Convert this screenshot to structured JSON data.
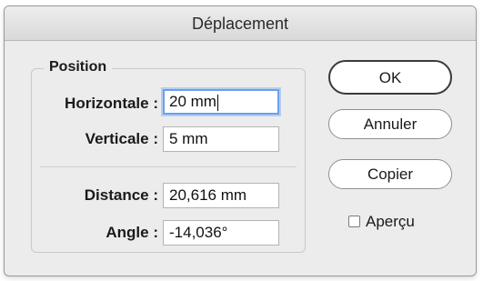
{
  "window": {
    "title": "Déplacement"
  },
  "position_group": {
    "legend": "Position",
    "horizontal": {
      "label": "Horizontale :",
      "value": "20 mm"
    },
    "vertical": {
      "label": "Verticale :",
      "value": "5 mm"
    },
    "distance": {
      "label": "Distance :",
      "value": "20,616 mm"
    },
    "angle": {
      "label": "Angle :",
      "value": "-14,036°"
    }
  },
  "buttons": {
    "ok": "OK",
    "cancel": "Annuler",
    "copy": "Copier"
  },
  "preview": {
    "label": "Aperçu",
    "checked": false
  }
}
